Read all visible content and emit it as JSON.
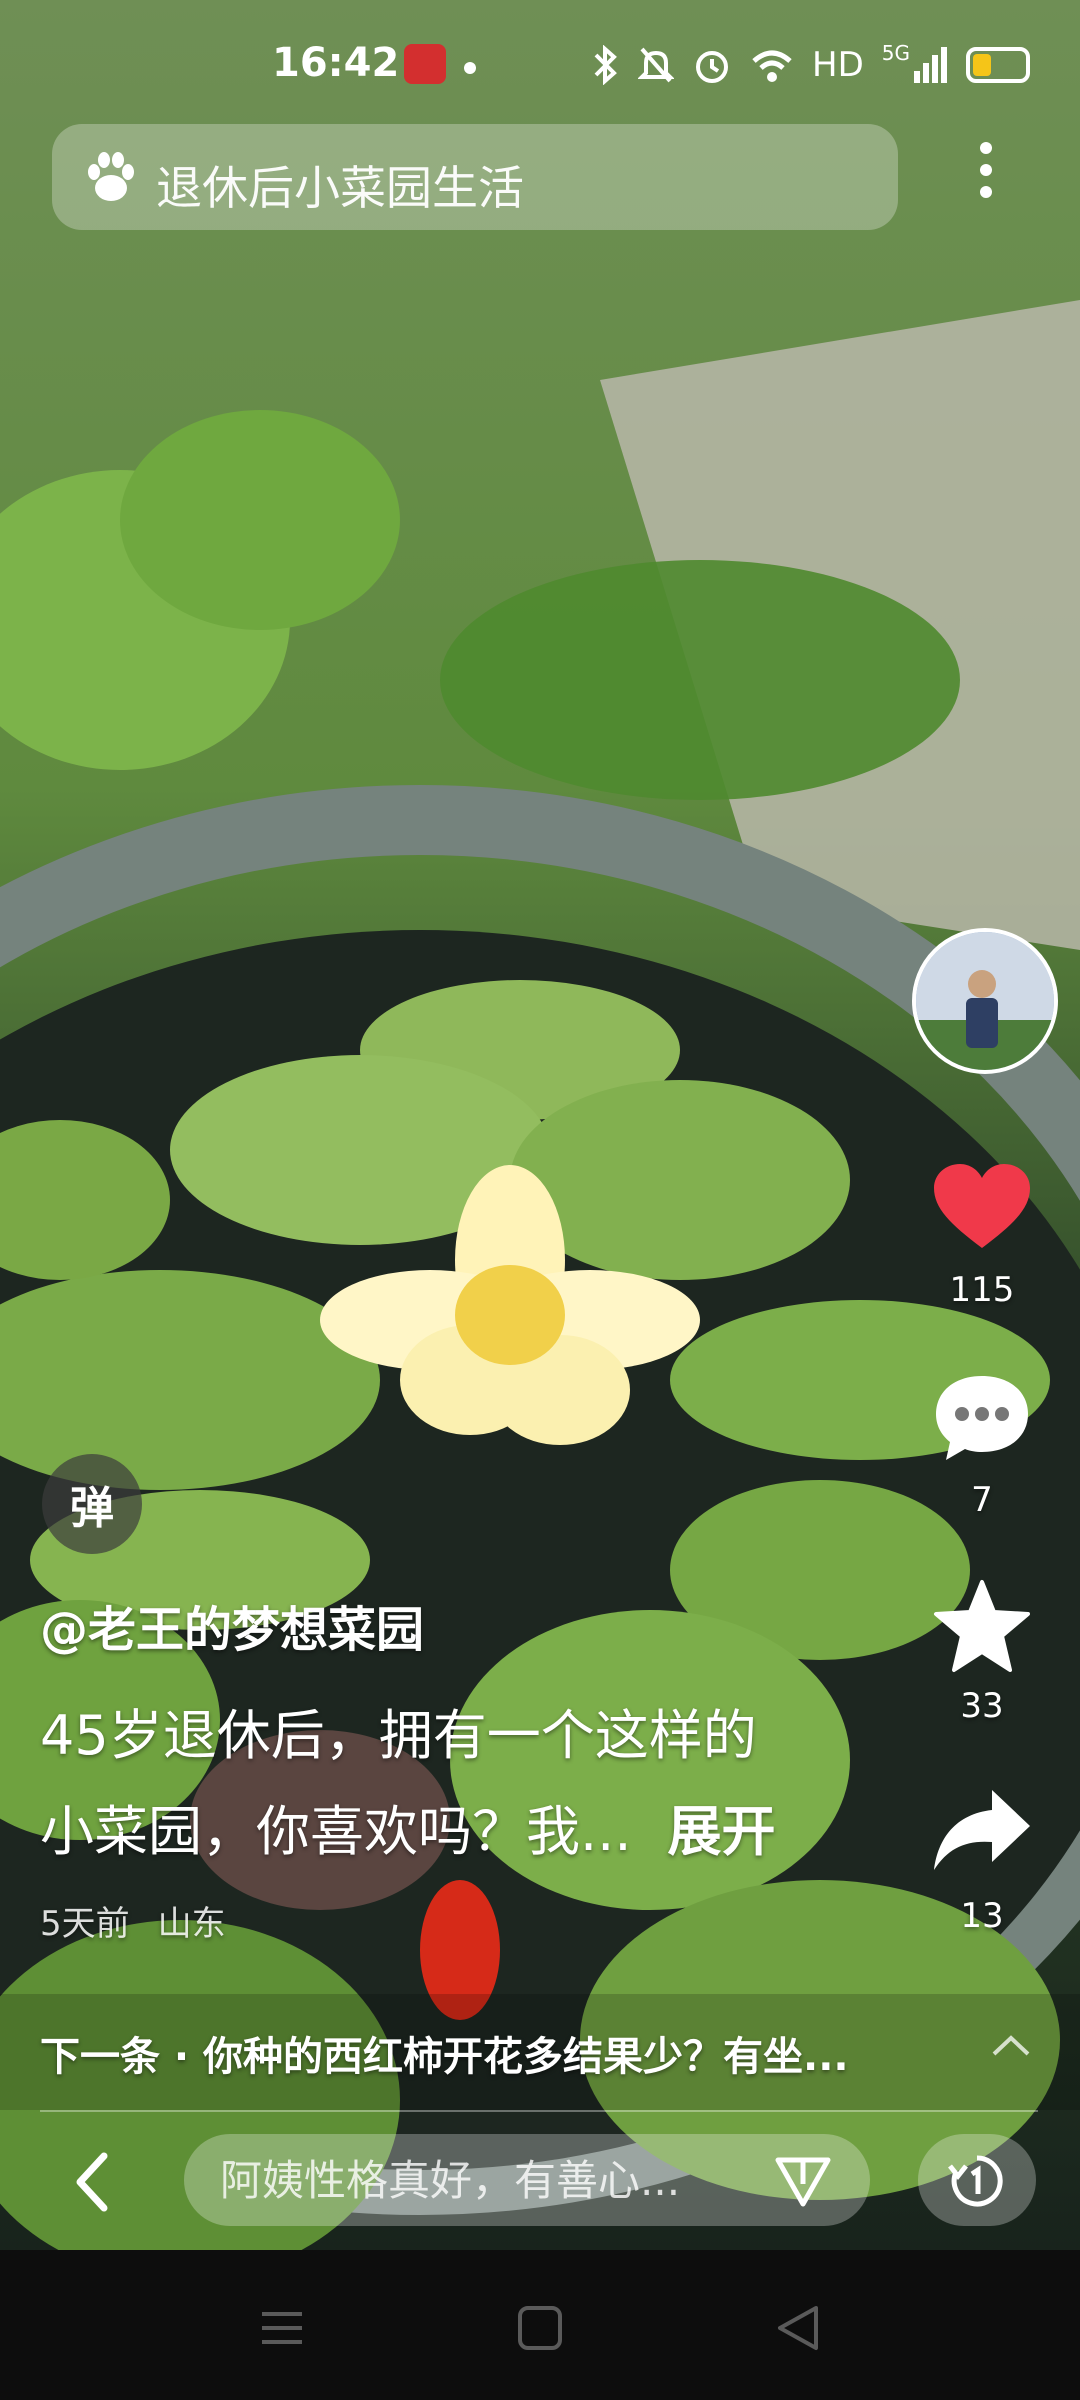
{
  "status_bar": {
    "time": "16:42",
    "network_label": "HD",
    "signal_label": "5G",
    "icons": [
      "bluetooth-icon",
      "mute-icon",
      "alarm-icon",
      "wifi-icon",
      "signal-icon",
      "battery-icon"
    ],
    "battery_color": "#f5c518"
  },
  "search": {
    "query": "退休后小菜园生活",
    "icon": "paw-icon"
  },
  "actions": {
    "likes": "115",
    "comments": "7",
    "favorites": "33",
    "shares": "13",
    "like_color": "#f0394a"
  },
  "danmaku": {
    "label": "弹"
  },
  "post": {
    "author": "@老王的梦想菜园",
    "caption_line1": "45岁退休后，拥有一个这样的",
    "caption_line2": "小菜园，你喜欢吗？我...",
    "expand_label": "展开",
    "time_ago": "5天前",
    "location": "山东"
  },
  "next_video": {
    "text": "下一条 · 你种的西红柿开花多结果少？有坐..."
  },
  "comment_bar": {
    "placeholder": "阿姨性格真好，有善心..."
  },
  "nav_bar": {
    "keys": [
      "menu-icon",
      "home-icon",
      "back-icon"
    ]
  }
}
